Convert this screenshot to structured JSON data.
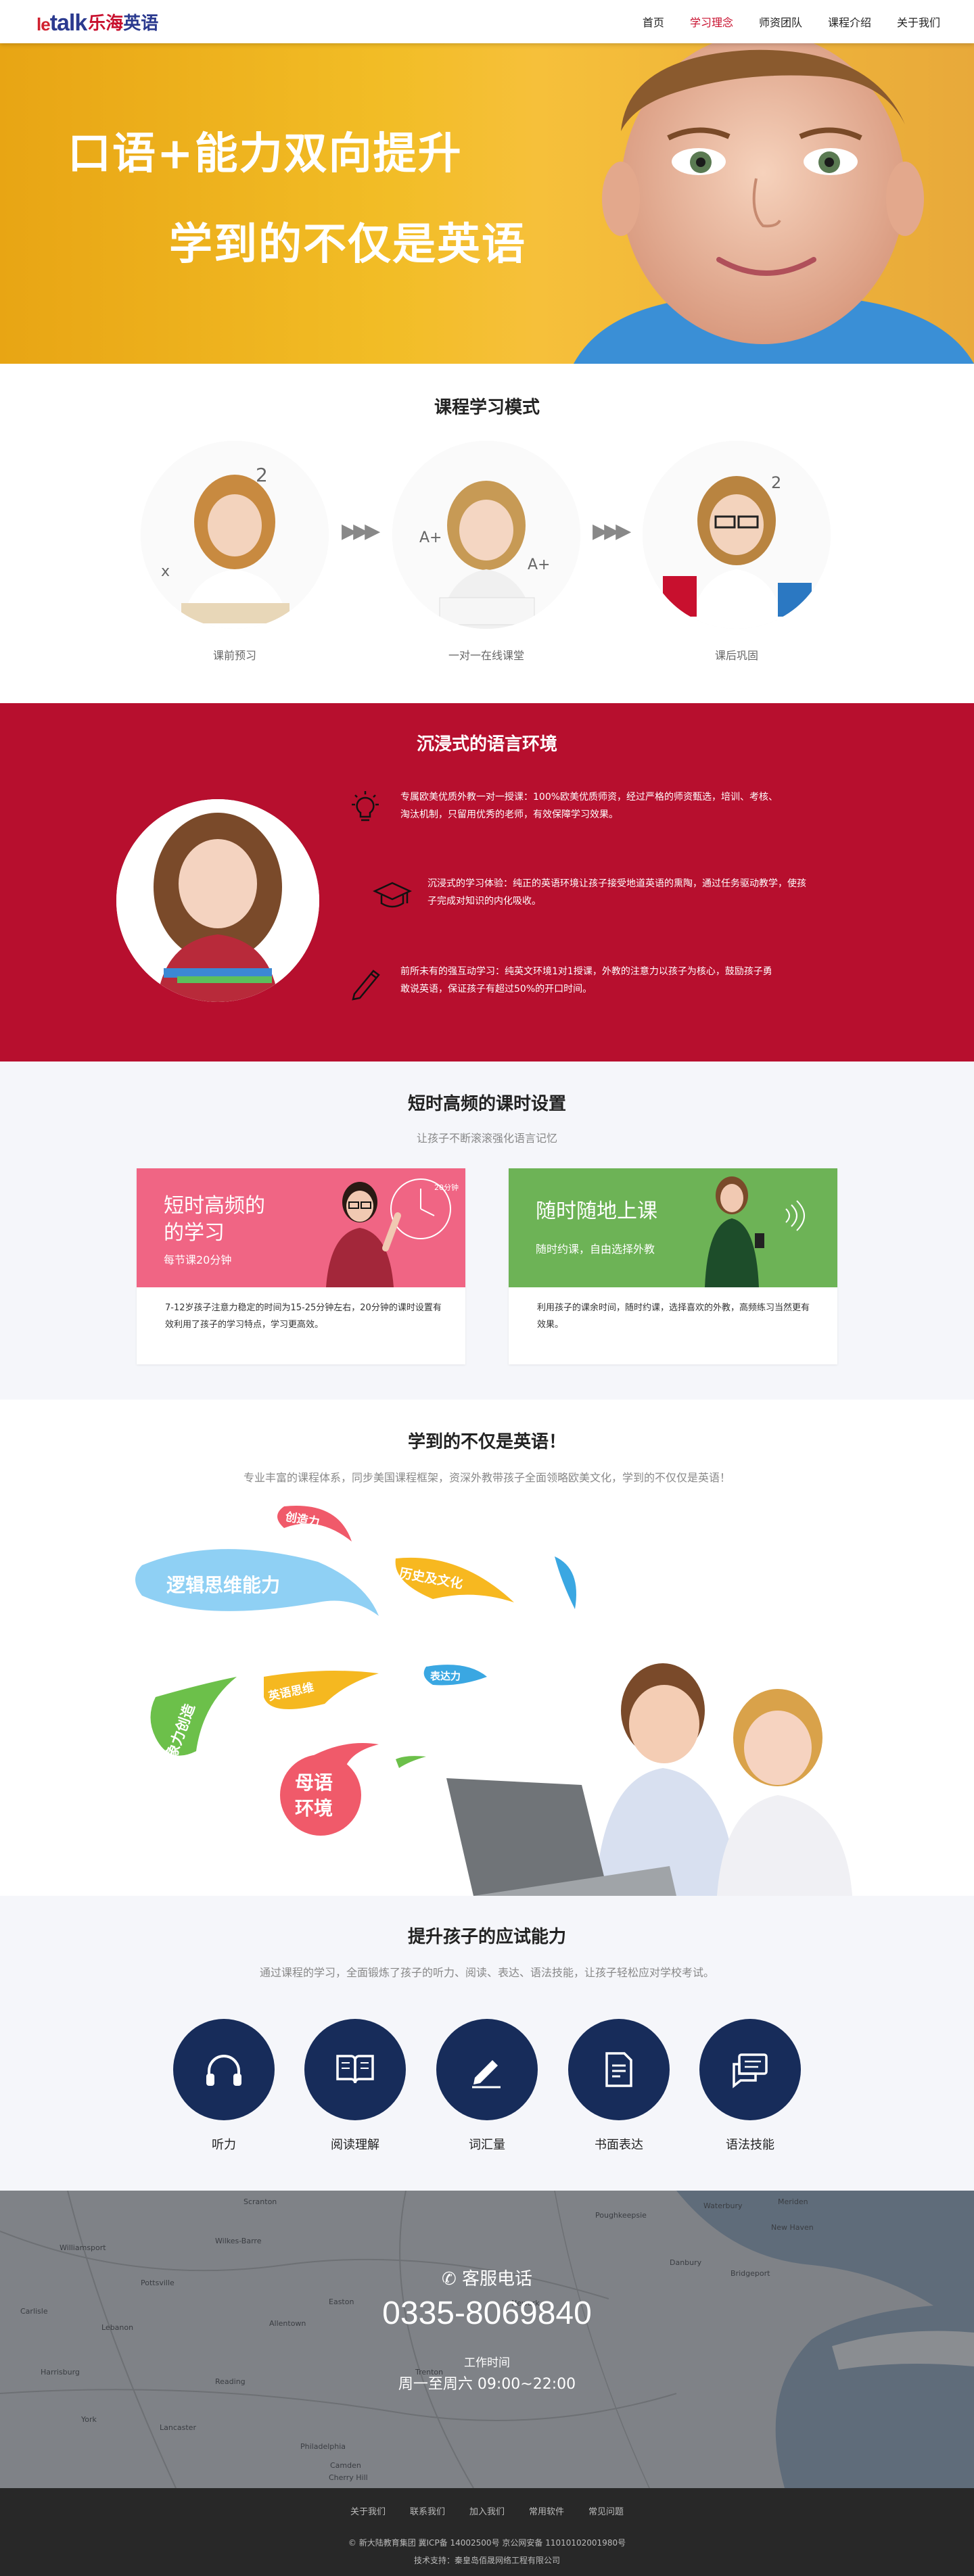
{
  "header": {
    "logo_latin": "talk",
    "logo_le": "le",
    "logo_cn_red": "乐海",
    "logo_cn_blue": "英语",
    "nav": [
      {
        "label": "首页",
        "active": false
      },
      {
        "label": "学习理念",
        "active": true
      },
      {
        "label": "师资团队",
        "active": false
      },
      {
        "label": "课程介绍",
        "active": false
      },
      {
        "label": "关于我们",
        "active": false
      }
    ]
  },
  "hero": {
    "line1": "口语+能力双向提升",
    "line2": "学到的不仅是英语"
  },
  "mode": {
    "title": "课程学习模式",
    "steps": [
      "课前预习",
      "一对一在线课堂",
      "课后巩固"
    ]
  },
  "immersive": {
    "title": "沉浸式的语言环境",
    "features": [
      {
        "icon": "lightbulb-icon",
        "text": "专属欧美优质外教一对一授课：100%欧美优质师资，经过严格的师资甄选，培训、考核、淘汰机制，只留用优秀的老师，有效保障学习效果。"
      },
      {
        "icon": "graduation-cap-icon",
        "text": "沉浸式的学习体验：纯正的英语环境让孩子接受地道英语的熏陶，通过任务驱动教学，使孩子完成对知识的内化吸收。"
      },
      {
        "icon": "pencil-icon",
        "text": "前所未有的强互动学习：纯英文环境1对1授课，外教的注意力以孩子为核心，鼓励孩子勇敢说英语，保证孩子有超过50%的开口时间。"
      }
    ]
  },
  "classes": {
    "title": "短时高频的课时设置",
    "subtitle": "让孩子不断滚滚强化语言记忆",
    "cards": [
      {
        "title_line1": "短时高频的",
        "title_line2": "的学习",
        "sub": "每节课20分钟",
        "clock_text": "20分钟",
        "desc": "7-12岁孩子注意力稳定的时间为15-25分钟左右，20分钟的课时设置有效利用了孩子的学习特点，学习更高效。"
      },
      {
        "title_line1": "随时随地上课",
        "title_line2": "",
        "sub": "随时约课，自由选择外教",
        "desc": "利用孩子的课余时间，随时约课，选择喜欢的外教，高频练习当然更有效果。"
      }
    ]
  },
  "notonly": {
    "title": "学到的不仅是英语！",
    "subtitle": "专业丰富的课程体系，同步美国课程框架，资深外教带孩子全面领略欧美文化，学到的不仅仅是英语！",
    "bubbles": {
      "creativity": "创造力",
      "logic": "逻辑思维能力",
      "history": "历史及文化",
      "expression": "表达力",
      "english_thinking": "英语思维",
      "imagination": "想象力创造",
      "mother_tongue_1": "母语",
      "mother_tongue_2": "环境"
    }
  },
  "ability": {
    "title": "提升孩子的应试能力",
    "subtitle": "通过课程的学习，全面锻炼了孩子的听力、阅读、表达、语法技能，让孩子轻松应对学校考试。",
    "items": [
      {
        "label": "听力",
        "icon": "headphones-icon"
      },
      {
        "label": "阅读理解",
        "icon": "book-icon"
      },
      {
        "label": "词汇量",
        "icon": "pen-icon"
      },
      {
        "label": "书面表达",
        "icon": "document-icon"
      },
      {
        "label": "语法技能",
        "icon": "chat-icon"
      }
    ]
  },
  "contact": {
    "label": "客服电话",
    "phone": "0335-8069840",
    "hours_label": "工作时间",
    "hours": "周一至周六 09:00~22:00",
    "map_labels": [
      "Scranton",
      "Williamsport",
      "Wilkes-Barre",
      "Allentown",
      "Reading",
      "Harrisburg",
      "Lancaster",
      "Philadelphia",
      "Trenton",
      "Newark",
      "New Haven",
      "Bridgeport",
      "Danbury",
      "Waterbury",
      "Meriden",
      "Easton",
      "Camden",
      "Cherry Hill",
      "Lebanon",
      "York",
      "Carlisle",
      "Pottsville",
      "Poughkeepsie"
    ]
  },
  "footer": {
    "links": [
      "关于我们",
      "联系我们",
      "加入我们",
      "常用软件",
      "常见问题"
    ],
    "copyright": "© 新大陆教育集团 冀ICP备 14002500号  京公网安备 11010102001980号",
    "support": "技术支持：秦皇岛佰晟网络工程有限公司"
  },
  "colors": {
    "brand_red": "#c8102e",
    "section_red": "#b70f2e",
    "navy": "#172c5a",
    "card_pink": "#f06584",
    "card_green": "#6db356"
  }
}
